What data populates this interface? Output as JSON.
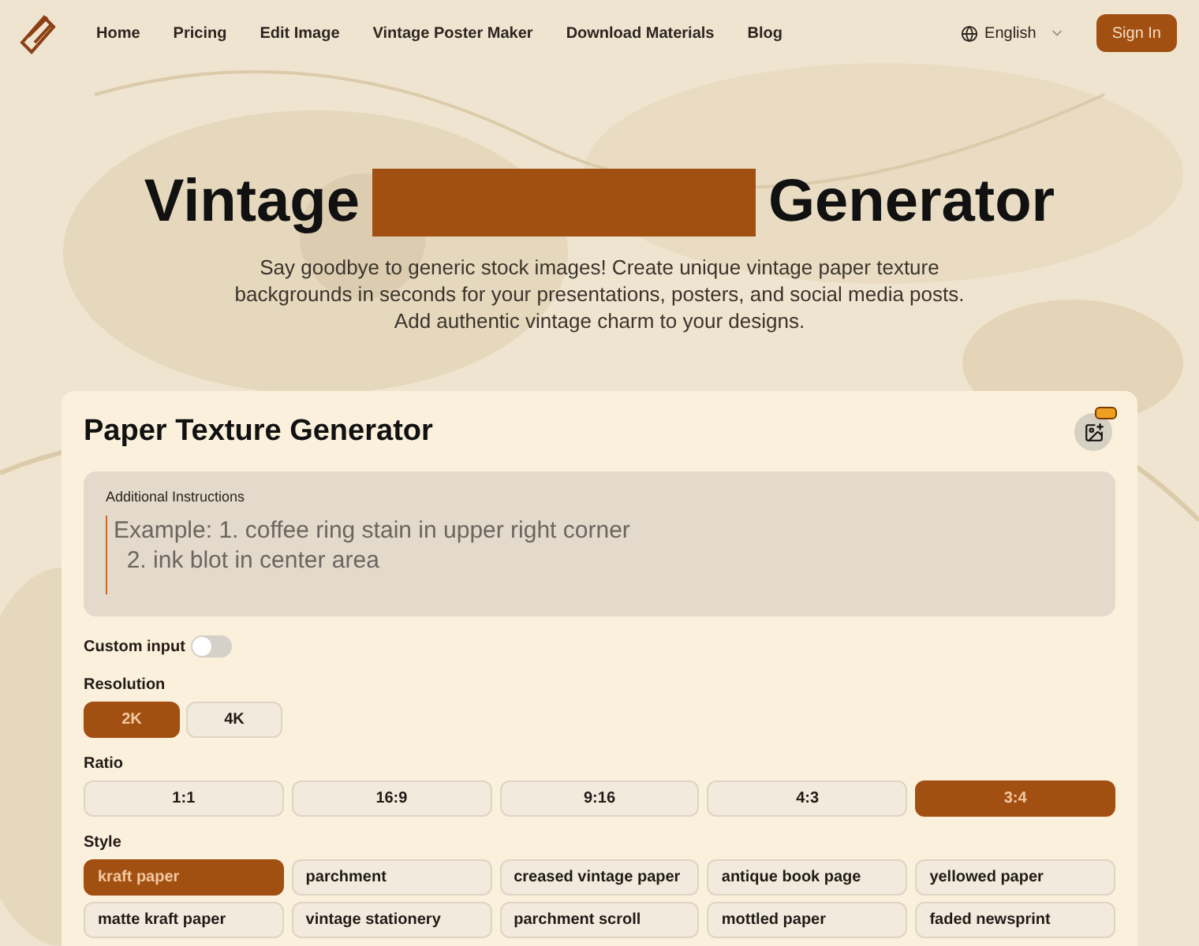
{
  "nav": {
    "links": [
      "Home",
      "Pricing",
      "Edit Image",
      "Vintage Poster Maker",
      "Download Materials",
      "Blog"
    ],
    "language": "English",
    "sign_in": "Sign In"
  },
  "hero": {
    "title_start": "Vintage",
    "title_end": "Generator",
    "subtitle": "Say goodbye to generic stock images! Create unique vintage paper texture backgrounds in seconds for your presentations, posters, and social media posts. Add authentic vintage charm to your designs."
  },
  "card": {
    "title": "Paper Texture Generator",
    "instructions": {
      "label": "Additional Instructions",
      "placeholder": "Example: 1. coffee ring stain in upper right corner\n  2. ink blot in center area"
    },
    "custom_input": {
      "label": "Custom input",
      "on": false
    },
    "resolution": {
      "label": "Resolution",
      "options": [
        {
          "label": "2K",
          "selected": true
        },
        {
          "label": "4K",
          "selected": false
        }
      ]
    },
    "ratio": {
      "label": "Ratio",
      "options": [
        {
          "label": "1:1",
          "selected": false
        },
        {
          "label": "16:9",
          "selected": false
        },
        {
          "label": "9:16",
          "selected": false
        },
        {
          "label": "4:3",
          "selected": false
        },
        {
          "label": "3:4",
          "selected": true
        }
      ]
    },
    "style": {
      "label": "Style",
      "options": [
        {
          "label": "kraft paper",
          "selected": true
        },
        {
          "label": "parchment",
          "selected": false
        },
        {
          "label": "creased vintage paper",
          "selected": false
        },
        {
          "label": "antique book page",
          "selected": false
        },
        {
          "label": "yellowed paper",
          "selected": false
        },
        {
          "label": "matte kraft paper",
          "selected": false
        },
        {
          "label": "vintage stationery",
          "selected": false
        },
        {
          "label": "parchment scroll",
          "selected": false
        },
        {
          "label": "mottled paper",
          "selected": false
        },
        {
          "label": "faded newsprint",
          "selected": false
        }
      ]
    }
  }
}
